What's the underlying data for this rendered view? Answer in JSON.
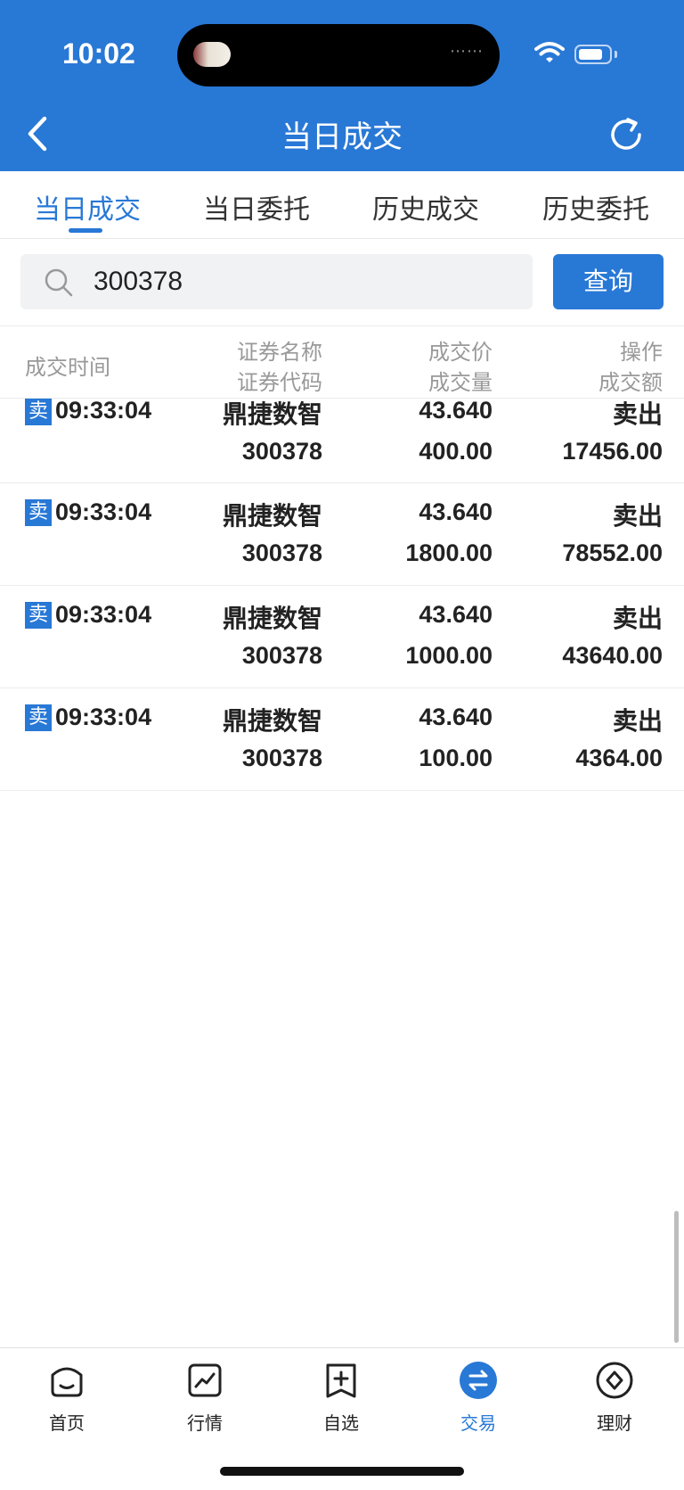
{
  "status_bar": {
    "time": "10:02"
  },
  "header": {
    "title": "当日成交"
  },
  "tabs": [
    {
      "label": "当日成交",
      "active": true
    },
    {
      "label": "当日委托",
      "active": false
    },
    {
      "label": "历史成交",
      "active": false
    },
    {
      "label": "历史委托",
      "active": false
    }
  ],
  "search": {
    "value": "300378",
    "button_label": "查询"
  },
  "table_header": {
    "time": "成交时间",
    "name": "证券名称",
    "code": "证券代码",
    "price": "成交价",
    "qty": "成交量",
    "op": "操作",
    "amount": "成交额"
  },
  "rows": [
    {
      "badge": "卖",
      "time": "09:33:04",
      "name": "鼎捷数智",
      "code": "300378",
      "price": "43.640",
      "qty": "400.00",
      "op": "卖出",
      "amount": "17456.00"
    },
    {
      "badge": "卖",
      "time": "09:33:04",
      "name": "鼎捷数智",
      "code": "300378",
      "price": "43.640",
      "qty": "1800.00",
      "op": "卖出",
      "amount": "78552.00"
    },
    {
      "badge": "卖",
      "time": "09:33:04",
      "name": "鼎捷数智",
      "code": "300378",
      "price": "43.640",
      "qty": "1000.00",
      "op": "卖出",
      "amount": "43640.00"
    },
    {
      "badge": "卖",
      "time": "09:33:04",
      "name": "鼎捷数智",
      "code": "300378",
      "price": "43.640",
      "qty": "100.00",
      "op": "卖出",
      "amount": "4364.00"
    }
  ],
  "bottom_nav": [
    {
      "label": "首页",
      "icon": "home-icon",
      "active": false
    },
    {
      "label": "行情",
      "icon": "chart-icon",
      "active": false
    },
    {
      "label": "自选",
      "icon": "add-bookmark-icon",
      "active": false
    },
    {
      "label": "交易",
      "icon": "exchange-icon",
      "active": true
    },
    {
      "label": "理财",
      "icon": "diamond-icon",
      "active": false
    }
  ],
  "colors": {
    "primary": "#2878d6",
    "text": "#222222",
    "muted": "#999999"
  }
}
